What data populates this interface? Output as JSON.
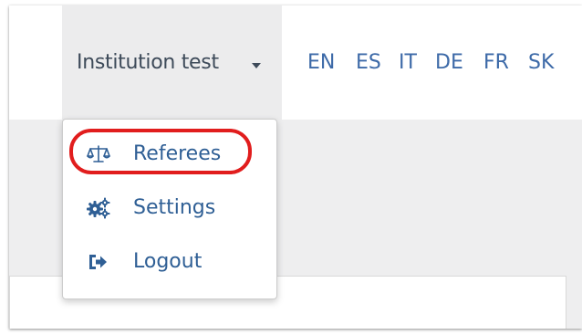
{
  "navbar": {
    "user_menu_label": "Institution test",
    "languages": [
      "EN",
      "ES",
      "IT",
      "DE",
      "FR",
      "SK"
    ]
  },
  "dropdown": {
    "items": [
      {
        "label": "Referees",
        "icon": "balance-scale-icon"
      },
      {
        "label": "Settings",
        "icon": "gears-icon"
      },
      {
        "label": "Logout",
        "icon": "sign-out-icon"
      }
    ]
  },
  "colors": {
    "link": "#3d6aa8",
    "menu_text": "#2f5f95",
    "highlight": "#e11d1d"
  }
}
